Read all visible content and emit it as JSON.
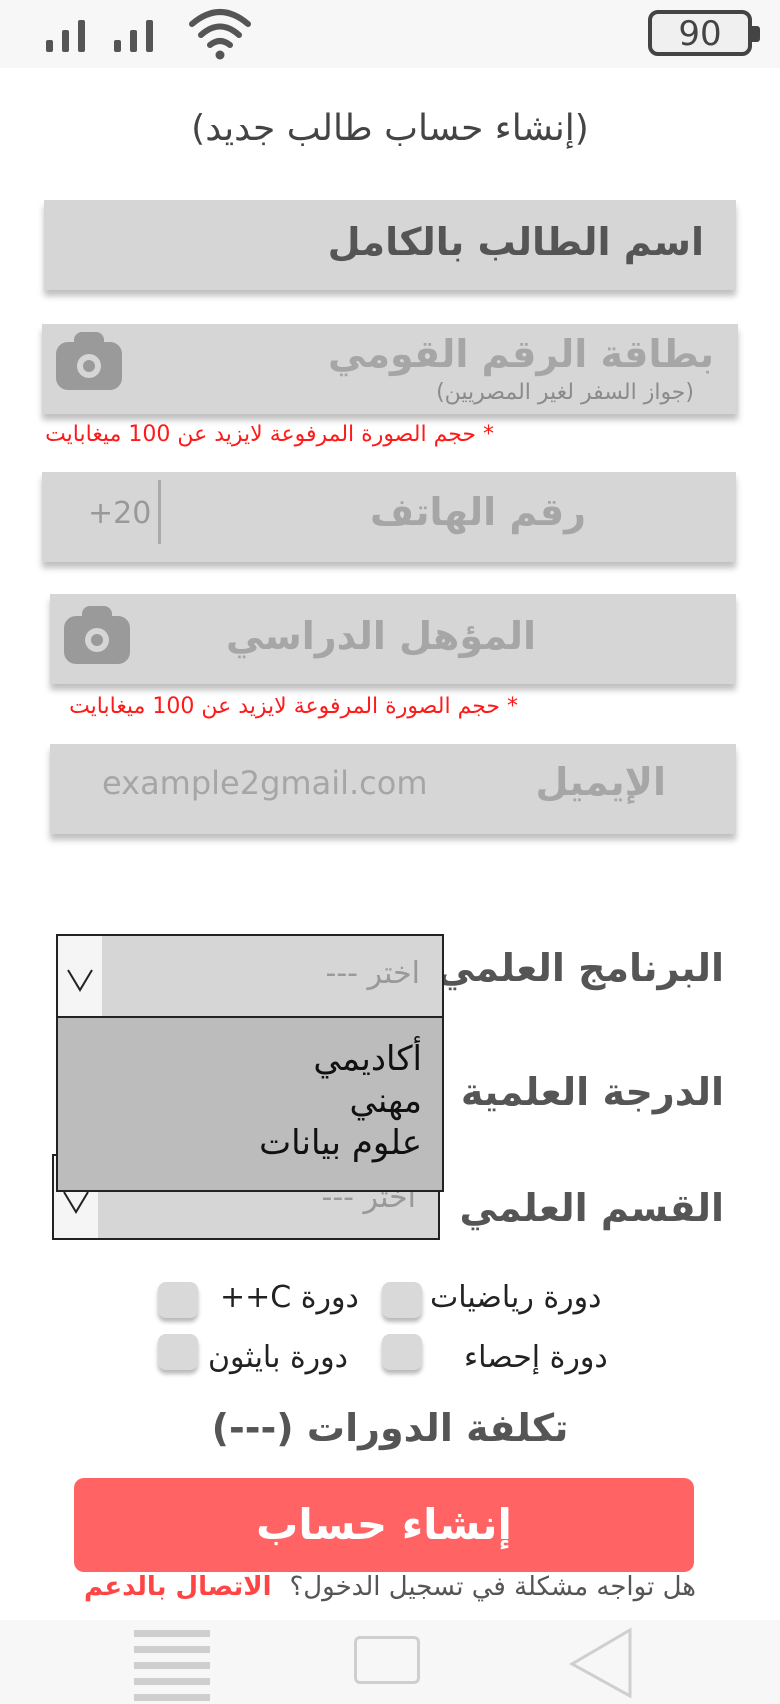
{
  "status_bar": {
    "battery": "90",
    "signal_icon": "signal-icon",
    "wifi_icon": "wifi-icon"
  },
  "page_title": "(إنشاء حساب طالب جديد)",
  "form": {
    "full_name": {
      "label": "اسم الطالب بالكامل"
    },
    "national_id": {
      "label": "بطاقة الرقم القومي",
      "hint": "(جواز السفر لغير المصريين)",
      "icon": "camera-icon",
      "size_note": "* حجم الصورة المرفوعة لايزيد عن 100 ميغابايت"
    },
    "phone": {
      "label": "رقم الهاتف",
      "prefix": "+20"
    },
    "qualification": {
      "label": "المؤهل الدراسي",
      "icon": "camera-icon",
      "size_note": "* حجم الصورة المرفوعة لايزيد عن 100 ميغابايت"
    },
    "email": {
      "label": "الإيميل",
      "placeholder": "example2gmail.com"
    }
  },
  "selects": {
    "program": {
      "label": "البرنامج العلمي",
      "placeholder": "اختر ---",
      "options": [
        "أكاديمي",
        "مهني",
        "علوم بيانات"
      ]
    },
    "degree": {
      "label": "الدرجة العلمية"
    },
    "department": {
      "label": "القسم العلمي",
      "placeholder": "اختر ---"
    }
  },
  "courses": [
    {
      "label": "دورة رياضيات"
    },
    {
      "label": "دورة C++"
    },
    {
      "label": "دورة إحصاء"
    },
    {
      "label": "دورة بايثون"
    }
  ],
  "courses_cost": "تكلفة الدورات (---)",
  "create_button": "إنشاء حساب",
  "support": {
    "question": "هل تواجه مشكلة في تسجيل الدخول؟",
    "link": "الاتصال بالدعم"
  },
  "nav": {
    "menu_icon": "menu-icon",
    "home_icon": "home-icon",
    "back_icon": "back-icon"
  },
  "colors": {
    "primary_button": "#ff6363",
    "error_text": "#ff1a1a",
    "field_bg": "#d6d6d6"
  }
}
